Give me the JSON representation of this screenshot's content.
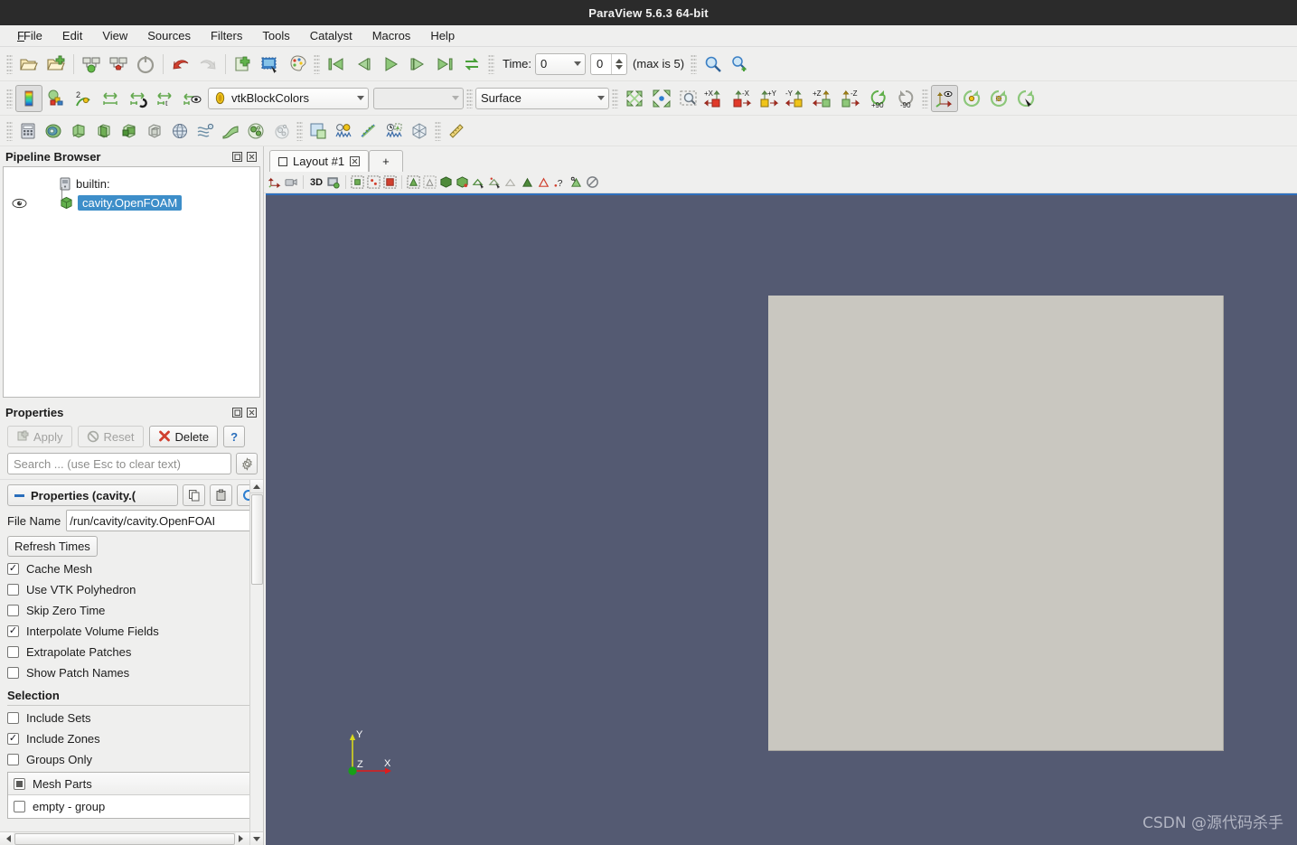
{
  "window": {
    "title": "ParaView 5.6.3 64-bit"
  },
  "menubar": {
    "items": [
      {
        "label": "File",
        "mnemonic": "F"
      },
      {
        "label": "Edit",
        "mnemonic": "E"
      },
      {
        "label": "View",
        "mnemonic": "V"
      },
      {
        "label": "Sources",
        "mnemonic": "S"
      },
      {
        "label": "Filters",
        "mnemonic": "l"
      },
      {
        "label": "Tools",
        "mnemonic": "T"
      },
      {
        "label": "Catalyst",
        "mnemonic": "C"
      },
      {
        "label": "Macros",
        "mnemonic": "M"
      },
      {
        "label": "Help",
        "mnemonic": "H"
      }
    ]
  },
  "toolbar_main": {
    "icons": [
      "open-file-icon",
      "open-recent-icon",
      "connect-server-icon",
      "disconnect-server-icon",
      "reload-icon",
      "undo-icon",
      "redo-icon",
      "save-data-icon",
      "save-screenshot-icon",
      "edit-color-map-icon"
    ],
    "vcr": [
      "first-frame-icon",
      "previous-frame-icon",
      "play-icon",
      "next-frame-icon",
      "last-frame-icon",
      "loop-icon"
    ],
    "time_label": "Time:",
    "time_value": "0",
    "frame_value": "0",
    "max_label": "(max is 5)",
    "zoom_icons": [
      "magnifier-icon",
      "magnifier-plus-icon"
    ]
  },
  "toolbar_repr": {
    "color_legend_icon": "color-legend-icon",
    "rescale_icons": [
      "edit-color-icon",
      "rescale-data-icon",
      "rescale-custom-icon",
      "rescale-temporal-icon",
      "rescale-visible-icon"
    ],
    "array_selected": "vtkBlockColors",
    "component_selected": "",
    "representation_selected": "Surface",
    "camera_icons": [
      "reset-camera-icon",
      "zoom-to-data-icon",
      "zoom-to-box-icon",
      "plus-x-icon",
      "minus-x-icon",
      "plus-y-icon",
      "minus-y-icon",
      "plus-z-icon",
      "minus-z-icon",
      "rotate-plus-90-icon",
      "rotate-minus-90-icon",
      "show-orientation-axes-icon",
      "rotate-center-icon",
      "pick-center-icon",
      "reset-center-icon"
    ],
    "rotate_plus_label": "+90",
    "rotate_minus_label": "-90"
  },
  "toolbar_filters": {
    "icons": [
      "calculator-icon",
      "contour-icon",
      "clip-icon",
      "slice-icon",
      "threshold-icon",
      "extract-subset-icon",
      "glyph-icon",
      "stream-tracer-icon",
      "warp-icon",
      "group-datasets-icon",
      "extract-level-icon",
      "split-view-icon",
      "plot-over-line-icon",
      "plot-selection-icon",
      "plot-data-over-time-icon",
      "axes-grid-icon",
      "ruler-icon"
    ]
  },
  "pipeline": {
    "title": "Pipeline Browser",
    "dock_buttons": [
      "float-icon",
      "close-icon"
    ],
    "server": "builtin:",
    "items": [
      {
        "label": "cavity.OpenFOAM",
        "selected": true,
        "visible": true,
        "icon": "dataset-icon"
      }
    ]
  },
  "properties": {
    "title": "Properties",
    "dock_buttons": [
      "float-icon",
      "close-icon"
    ],
    "apply_label": "Apply",
    "reset_label": "Reset",
    "delete_label": "Delete",
    "help_label": "?",
    "search_placeholder": "Search ... (use Esc to clear text)",
    "gear_icon": "gear-icon",
    "section_header": "Properties (cavity.(",
    "header_icons": [
      "copy-icon",
      "paste-icon",
      "restore-defaults-icon"
    ],
    "file_name_label": "File Name",
    "file_name_value": "/run/cavity/cavity.OpenFOAI",
    "refresh_times_label": "Refresh Times",
    "checkboxes": [
      {
        "label": "Cache Mesh",
        "checked": true
      },
      {
        "label": "Use VTK Polyhedron",
        "checked": false
      },
      {
        "label": "Skip Zero Time",
        "checked": false
      },
      {
        "label": "Interpolate Volume Fields",
        "checked": true
      },
      {
        "label": "Extrapolate Patches",
        "checked": false
      },
      {
        "label": "Show Patch Names",
        "checked": false
      }
    ],
    "selection_title": "Selection",
    "selection_checkboxes": [
      {
        "label": "Include Sets",
        "checked": false
      },
      {
        "label": "Include Zones",
        "checked": true
      },
      {
        "label": "Groups Only",
        "checked": false
      }
    ],
    "mesh_parts_label": "Mesh Parts",
    "mesh_parts_state": "partial",
    "mesh_parts_items": [
      {
        "label": "empty - group",
        "checked": false
      }
    ]
  },
  "layout": {
    "tab_label": "Layout #1",
    "tab_close_icon": "close-icon",
    "add_tab_label": "+",
    "view_toolbar": {
      "mode_label": "3D",
      "icons": [
        "interaction-mode-icon",
        "camera-link-icon",
        "3d-label",
        "capture-view-icon",
        "select-cells-icon",
        "select-points-icon",
        "select-cells-through-icon",
        "select-points-through-icon",
        "select-block-icon",
        "frustum-cells-icon",
        "frustum-points-icon",
        "interactive-select-cells-icon",
        "interactive-select-points-icon",
        "hover-cells-icon",
        "hover-points-icon",
        "select-custom-icon",
        "query-icon",
        "zoom-to-selection-icon",
        "clear-selection-icon"
      ]
    }
  },
  "render_view": {
    "background_color": "#545a72",
    "object_color": "#c9c7c0",
    "orientation_axes": {
      "x_label": "X",
      "x_color": "#e01b1b",
      "y_label": "Y",
      "y_color": "#d8d81e",
      "z_label": "Z",
      "z_color": "#17a017"
    },
    "watermark": "CSDN @源代码杀手"
  }
}
